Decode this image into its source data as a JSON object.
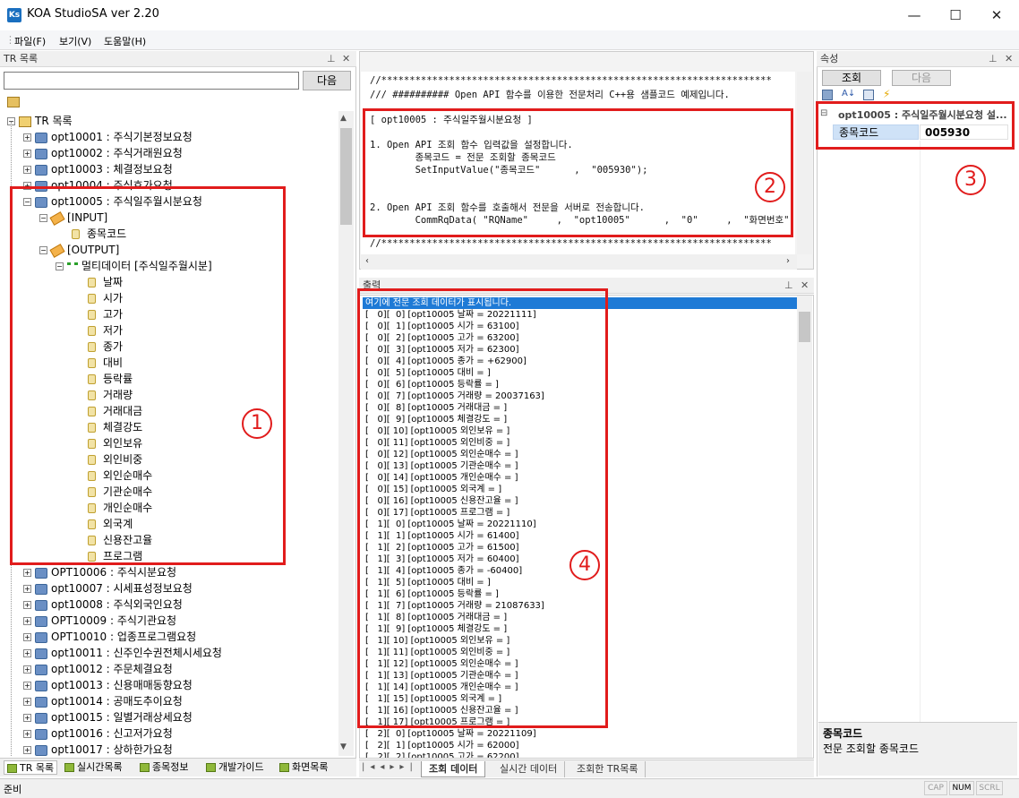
{
  "app": {
    "title": "KOA StudioSA ver 2.20",
    "logo": "Ks"
  },
  "window_controls": {
    "minimize": "—",
    "maximize": "☐",
    "close": "✕"
  },
  "menu": [
    "파일(F)",
    "보기(V)",
    "도움말(H)"
  ],
  "tr_panel": {
    "title": "TR 목록",
    "search_value": "",
    "search_button": "다음",
    "root": "TR 목록",
    "items_top": [
      "opt10001 : 주식기본정보요청",
      "opt10002 : 주식거래원요청",
      "opt10003 : 체결정보요청",
      "opt10004 : 주식호가요청"
    ],
    "selected_item": "opt10005 : 주식일주월시분요청",
    "input_node": "[INPUT]",
    "input_fields": [
      "종목코드"
    ],
    "output_node": "[OUTPUT]",
    "multi_node": "멀티데이터 [주식일주월시분]",
    "output_fields": [
      "날짜",
      "시가",
      "고가",
      "저가",
      "종가",
      "대비",
      "등락률",
      "거래량",
      "거래대금",
      "체결강도",
      "외인보유",
      "외인비중",
      "외인순매수",
      "기관순매수",
      "개인순매수",
      "외국계",
      "신용잔고율",
      "프로그램"
    ],
    "items_bottom": [
      "OPT10006 : 주식시분요청",
      "opt10007 : 시세표성정보요청",
      "opt10008 : 주식외국인요청",
      "OPT10009 : 주식기관요청",
      "OPT10010 : 업종프로그램요청",
      "opt10011 : 신주인수권전체시세요청",
      "opt10012 : 주문체결요청",
      "opt10013 : 신용매매동향요청",
      "opt10014 : 공매도추이요청",
      "opt10015 : 일별거래상세요청",
      "opt10016 : 신고저가요청",
      "opt10017 : 상하한가요청"
    ]
  },
  "left_tabs": [
    "TR 목록",
    "실시간목록",
    "종목정보",
    "개발가이드",
    "화면목록"
  ],
  "code_panel": {
    "lines": [
      "//*********************************************************************",
      "/// ########## Open API 함수를 이용한 전문처리 C++용 샘플코드 예제입니다.",
      "",
      "[ opt10005 : 주식일주월시분요청 ]",
      "",
      "1. Open API 조회 함수 입력값을 설정합니다.",
      "        종목코드 = 전문 조회할 종목코드",
      "        SetInputValue(\"종목코드\"      ,  \"005930\");",
      "",
      "",
      "2. Open API 조회 함수를 호출해서 전문을 서버로 전송합니다.",
      "        CommRqData( \"RQName\"     ,  \"opt10005\"      ,  \"0\"     ,  \"화면번호\");",
      "",
      "//*********************************************************************"
    ]
  },
  "output_panel": {
    "title": "출력",
    "header": "여기에 전문 조회 데이터가 표시됩니다.",
    "lines": [
      "[   0][  0] [opt10005 날짜 = 20221111]",
      "[   0][  1] [opt10005 시가 = 63100]",
      "[   0][  2] [opt10005 고가 = 63200]",
      "[   0][  3] [opt10005 저가 = 62300]",
      "[   0][  4] [opt10005 종가 = +62900]",
      "[   0][  5] [opt10005 대비 = ]",
      "[   0][  6] [opt10005 등락률 = ]",
      "[   0][  7] [opt10005 거래량 = 20037163]",
      "[   0][  8] [opt10005 거래대금 = ]",
      "[   0][  9] [opt10005 체결강도 = ]",
      "[   0][ 10] [opt10005 외인보유 = ]",
      "[   0][ 11] [opt10005 외인비중 = ]",
      "[   0][ 12] [opt10005 외인순매수 = ]",
      "[   0][ 13] [opt10005 기관순매수 = ]",
      "[   0][ 14] [opt10005 개인순매수 = ]",
      "[   0][ 15] [opt10005 외국계 = ]",
      "[   0][ 16] [opt10005 신용잔고율 = ]",
      "[   0][ 17] [opt10005 프로그램 = ]",
      "[   1][  0] [opt10005 날짜 = 20221110]",
      "[   1][  1] [opt10005 시가 = 61400]",
      "[   1][  2] [opt10005 고가 = 61500]",
      "[   1][  3] [opt10005 저가 = 60400]",
      "[   1][  4] [opt10005 종가 = -60400]",
      "[   1][  5] [opt10005 대비 = ]",
      "[   1][  6] [opt10005 등락률 = ]",
      "[   1][  7] [opt10005 거래량 = 21087633]",
      "[   1][  8] [opt10005 거래대금 = ]",
      "[   1][  9] [opt10005 체결강도 = ]",
      "[   1][ 10] [opt10005 외인보유 = ]",
      "[   1][ 11] [opt10005 외인비중 = ]",
      "[   1][ 12] [opt10005 외인순매수 = ]",
      "[   1][ 13] [opt10005 기관순매수 = ]",
      "[   1][ 14] [opt10005 개인순매수 = ]",
      "[   1][ 15] [opt10005 외국계 = ]",
      "[   1][ 16] [opt10005 신용잔고율 = ]",
      "[   1][ 17] [opt10005 프로그램 = ]",
      "[   2][  0] [opt10005 날짜 = 20221109]",
      "[   2][  1] [opt10005 시가 = 62000]",
      "[   2][  2] [opt10005 고가 = 62200]"
    ]
  },
  "output_tabs": [
    "조회 데이터",
    "실시간 데이터",
    "조회한 TR목록"
  ],
  "props_panel": {
    "title": "속성",
    "query_button": "조회",
    "next_button": "다음",
    "group": "opt10005 : 주식일주월시분요청 설...",
    "field_name": "종목코드",
    "field_value": "005930",
    "desc_title": "종목코드",
    "desc_text": "전문 조회할 종목코드"
  },
  "annotations": [
    "1",
    "2",
    "3",
    "4"
  ],
  "status": {
    "left": "준비",
    "cap": "CAP",
    "num": "NUM",
    "scrl": "SCRL"
  }
}
